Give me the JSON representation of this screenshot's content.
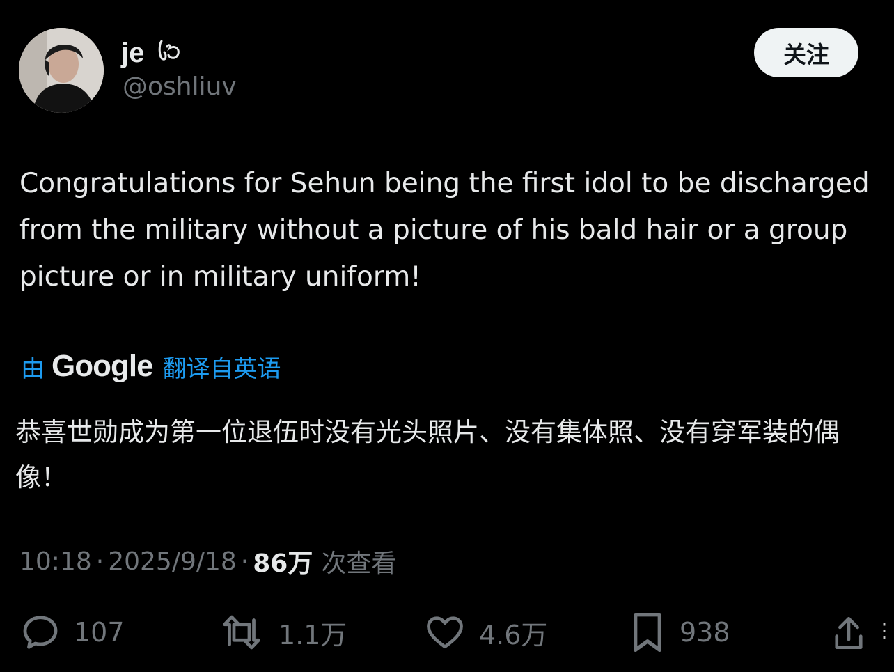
{
  "user": {
    "display_name": "je",
    "handle": "@oshliuv"
  },
  "follow_button": {
    "label": "关注"
  },
  "tweet": {
    "text": "Congratulations for Sehun being the first idol to be discharged from the military without a picture of his bald hair or a group picture or in military uniform!"
  },
  "translation": {
    "by_label": "由",
    "provider": "Google",
    "from_label": "翻译自英语",
    "text": "恭喜世勋成为第一位退伍时没有光头照片、没有集体照、没有穿军装的偶像！"
  },
  "meta": {
    "time": "10:18",
    "date": "2025/9/18",
    "views_count": "86万",
    "views_label": "次查看",
    "separator": "·"
  },
  "actions": {
    "reply": {
      "icon": "reply-icon",
      "count": "107"
    },
    "repost": {
      "icon": "repost-icon",
      "count": "1.1万"
    },
    "like": {
      "icon": "heart-icon",
      "count": "4.6万"
    },
    "bookmark": {
      "icon": "bookmark-icon",
      "count": "938"
    },
    "share": {
      "icon": "share-icon"
    }
  },
  "colors": {
    "background": "#000000",
    "primary_text": "#e7e9ea",
    "secondary_text": "#71767b",
    "link_blue": "#1d9bf0",
    "follow_button_bg": "#eff3f4"
  }
}
